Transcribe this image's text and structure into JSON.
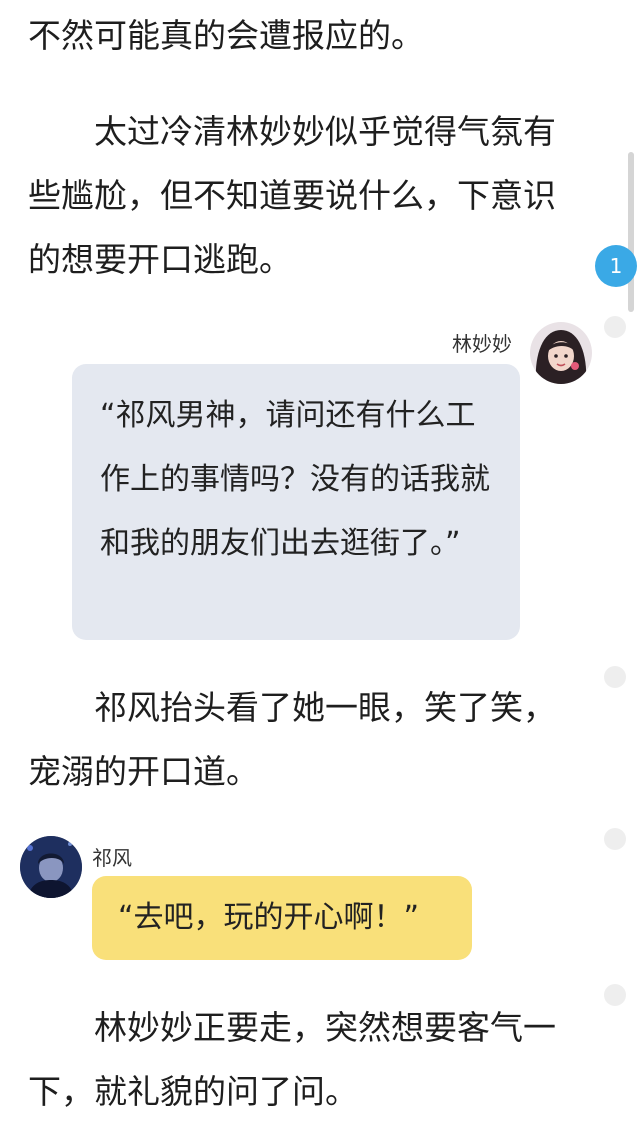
{
  "paragraphs": [
    "不然可能真的会遭报应的。",
    "太过冷清林妙妙似乎觉得气氛有些尴尬，但不知道要说什么，下意识的想要开口逃跑。",
    "祁风抬头看了她一眼，笑了笑，宠溺的开口道。",
    "林妙妙正要走，突然想要客气一下，就礼貌的问了问。"
  ],
  "messages": [
    {
      "sender": "林妙妙",
      "text": "“祁风男神，请问还有什么工作上的事情吗？没有的话我就和我的朋友们出去逛街了。”",
      "bubble_color": "#e4e8f0"
    },
    {
      "sender": "祁风",
      "text": "“去吧，玩的开心啊！”",
      "bubble_color": "#f9e07a"
    }
  ],
  "comment_badge": {
    "count": "1",
    "color": "#3aa9e6"
  }
}
